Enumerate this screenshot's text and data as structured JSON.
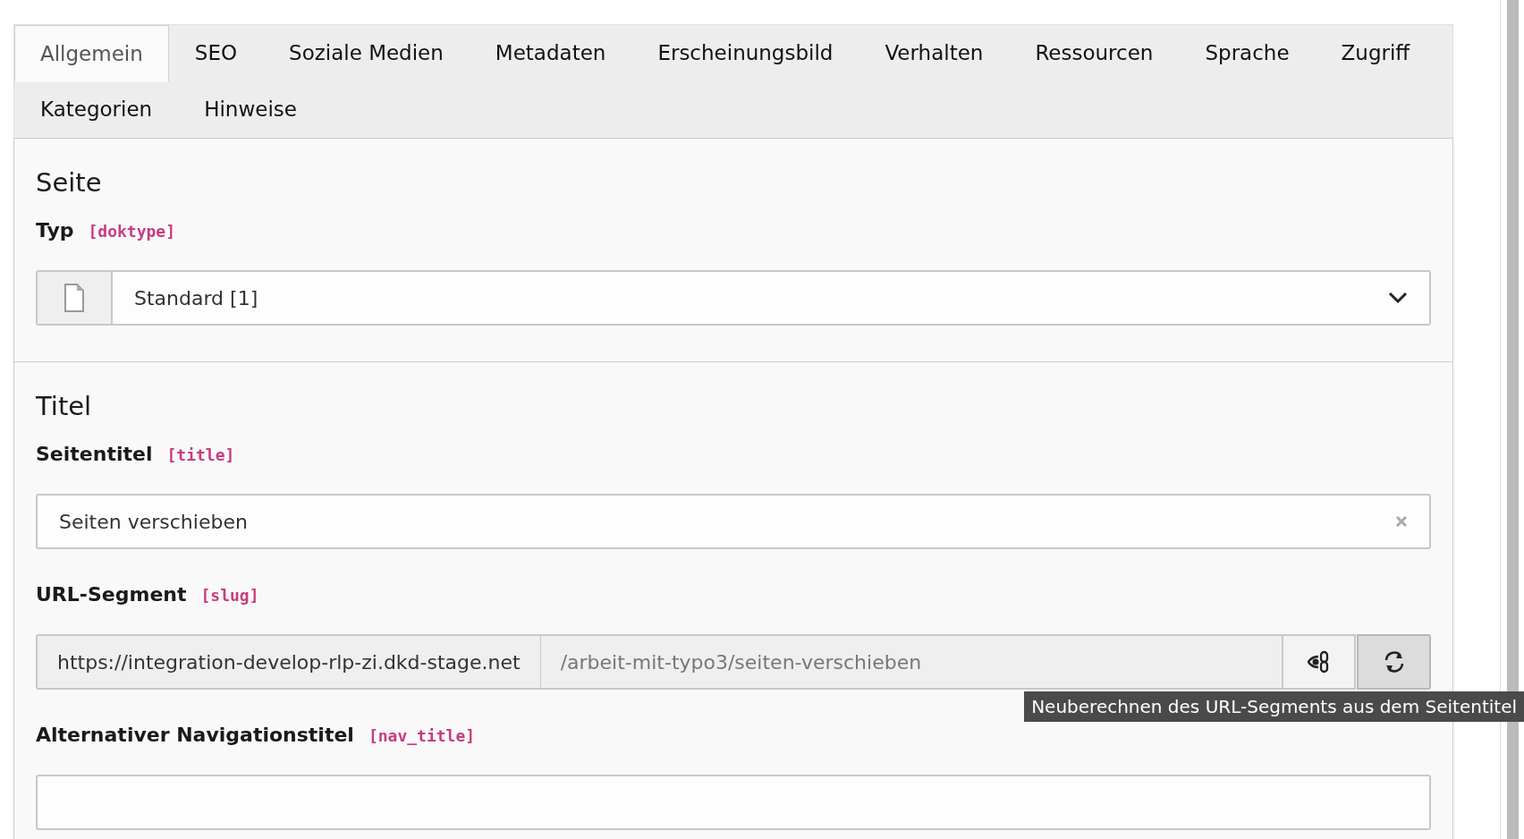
{
  "tabs": [
    {
      "label": "Allgemein",
      "selected": true
    },
    {
      "label": "SEO",
      "selected": false
    },
    {
      "label": "Soziale Medien",
      "selected": false
    },
    {
      "label": "Metadaten",
      "selected": false
    },
    {
      "label": "Erscheinungsbild",
      "selected": false
    },
    {
      "label": "Verhalten",
      "selected": false
    },
    {
      "label": "Ressourcen",
      "selected": false
    },
    {
      "label": "Sprache",
      "selected": false
    },
    {
      "label": "Zugriff",
      "selected": false
    },
    {
      "label": "Kategorien",
      "selected": false
    },
    {
      "label": "Hinweise",
      "selected": false
    }
  ],
  "sections": [
    {
      "title": "Seite",
      "fields": [
        {
          "kind": "select",
          "label": "Typ",
          "field_name": "[doktype]",
          "value": "Standard [1]"
        }
      ]
    },
    {
      "title": "Titel",
      "fields": [
        {
          "kind": "text",
          "label": "Seitentitel",
          "field_name": "[title]",
          "value": "Seiten verschieben"
        },
        {
          "kind": "slug",
          "label": "URL-Segment",
          "field_name": "[slug]",
          "prefix": "https://integration-develop-rlp-zi.dkd-stage.net",
          "value": "/arbeit-mit-typo3/seiten-verschieben",
          "tooltip": "Neuberechnen des URL-Segments aus dem Seitentitel"
        },
        {
          "kind": "text",
          "label": "Alternativer Navigationstitel",
          "field_name": "[nav_title]"
        }
      ]
    }
  ]
}
